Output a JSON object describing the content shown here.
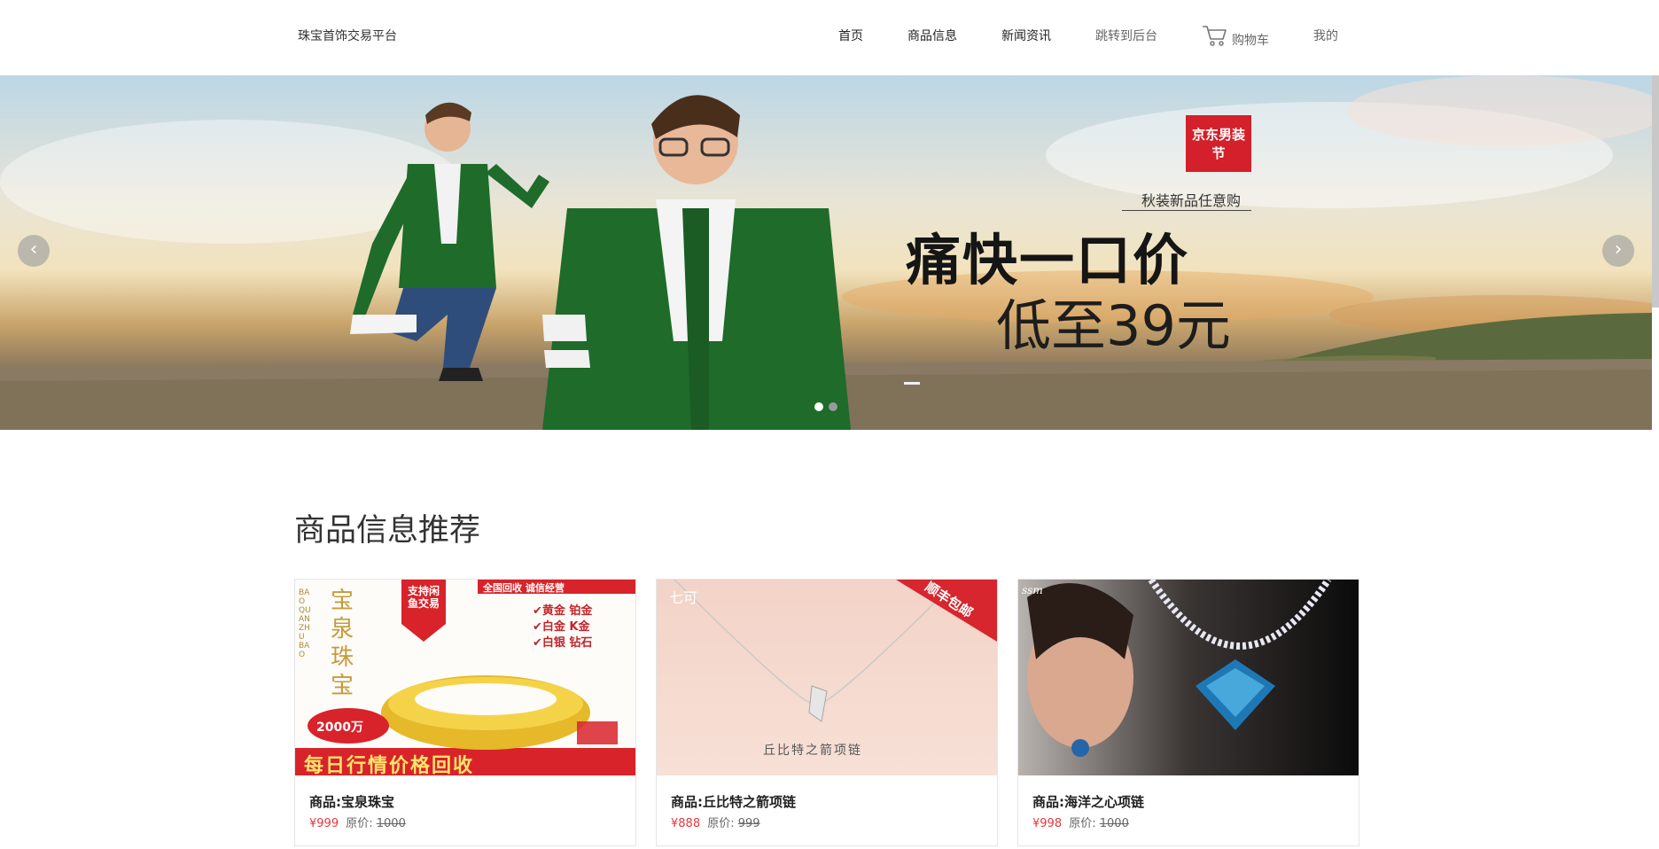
{
  "header": {
    "site_name": "珠宝首饰交易平台",
    "nav": [
      {
        "label": "首页"
      },
      {
        "label": "商品信息"
      },
      {
        "label": "新闻资讯"
      },
      {
        "label": "跳转到后台"
      },
      {
        "label": "购物车"
      },
      {
        "label": "我的"
      }
    ]
  },
  "banner": {
    "brand_badge": "京东男装节",
    "slogan_small": "秋装新品任意购",
    "slogan_big": "痛快一口价",
    "slogan_price": "低至39元",
    "prev_symbol": "‹",
    "next_symbol": "›",
    "dots": 2,
    "active_dot": 0
  },
  "section": {
    "title": "商品信息推荐"
  },
  "products": [
    {
      "name": "商品:宝泉珠宝",
      "price": "¥999",
      "orig_label": "原价:",
      "orig_price": "1000",
      "image_texts": {
        "brand_vertical": "宝泉珠宝",
        "brand_pinyin": "BAO QUAN ZHU BAO",
        "tag": "支持闲鱼交易",
        "top_banner": "全国回收 诚信经营",
        "items": [
          "✔黄金 铂金",
          "✔白金 K金",
          "✔白银 钻石"
        ],
        "capital": "2000万",
        "bottom": "每日行情价格回收"
      }
    },
    {
      "name": "商品:丘比特之箭项链",
      "price": "¥888",
      "orig_label": "原价:",
      "orig_price": "999",
      "image_texts": {
        "corner": "顺丰包邮",
        "caption": "丘比特之箭项链"
      }
    },
    {
      "name": "商品:海洋之心项链",
      "price": "¥998",
      "orig_label": "原价:",
      "orig_price": "1000",
      "image_texts": {}
    }
  ],
  "colors": {
    "accent_red": "#e4393c",
    "badge_red": "#d4202a",
    "sweater_green": "#1e6b2a"
  }
}
